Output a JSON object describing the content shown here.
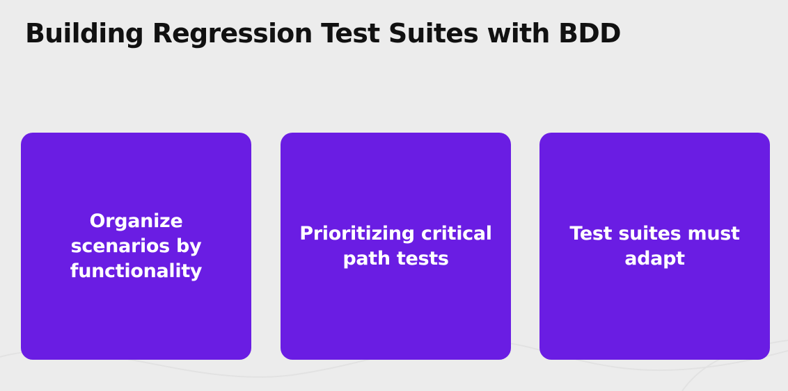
{
  "slide": {
    "title": "Building Regression Test Suites with BDD",
    "accent_color": "#6a1de3",
    "cards": [
      {
        "label": "Organize scenarios by functionality"
      },
      {
        "label": "Prioritizing critical path tests"
      },
      {
        "label": "Test suites must adapt"
      }
    ]
  }
}
